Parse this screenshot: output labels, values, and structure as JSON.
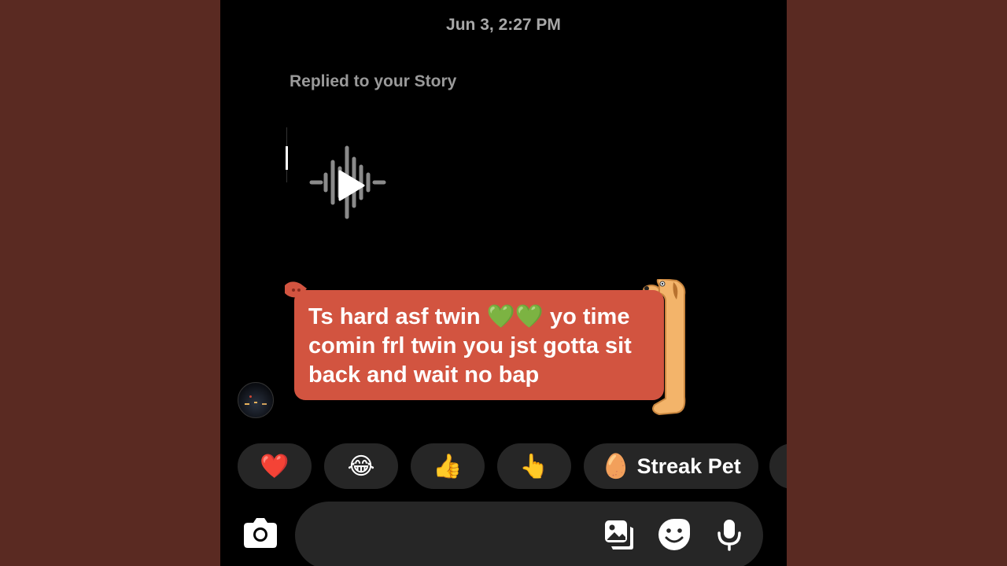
{
  "header": {
    "timestamp": "Jun 3, 2:27 PM"
  },
  "story_reply": {
    "label": "Replied to your Story"
  },
  "message": {
    "line1": "Ts hard asf twin 💚💚 yo time",
    "line2": "comin frl twin you jst gotta sit",
    "line3": "back and wait no bap"
  },
  "quick_reactions": [
    {
      "emoji": "❤️",
      "label": ""
    },
    {
      "emoji": "😂",
      "label": ""
    },
    {
      "emoji": "👍",
      "label": ""
    },
    {
      "emoji": "👆",
      "label": ""
    },
    {
      "emoji": "🥚",
      "label": "Streak Pet"
    }
  ],
  "composer": {
    "icons": [
      "camera-icon",
      "gallery-icon",
      "sticker-icon",
      "microphone-icon"
    ]
  },
  "colors": {
    "background": "#5a2a22",
    "screen": "#000000",
    "bubble": "#d25440",
    "pill": "#262626",
    "muted_text": "#a8a8a8"
  }
}
